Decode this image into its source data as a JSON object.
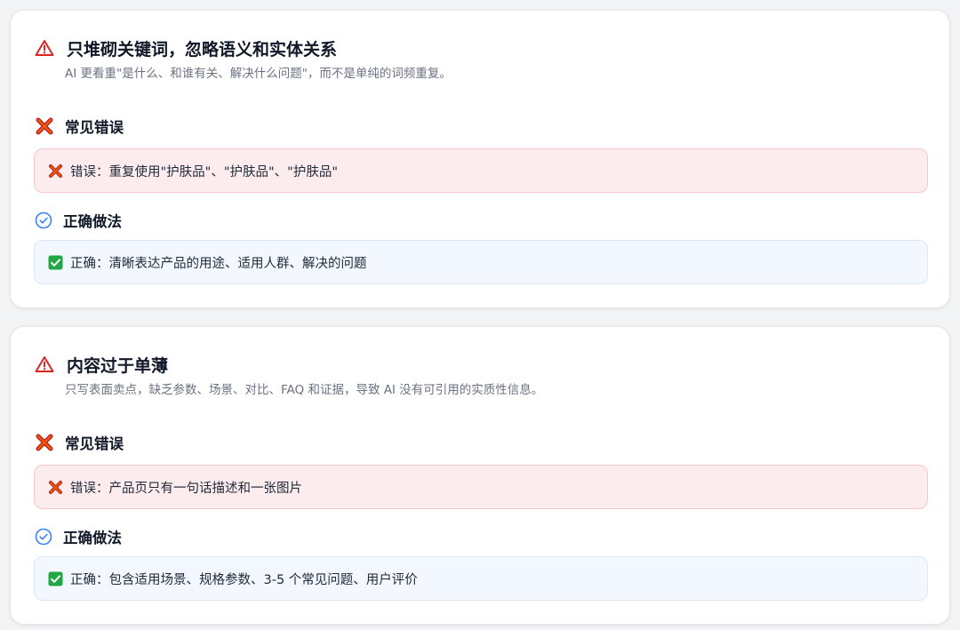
{
  "cards": [
    {
      "title": "只堆砌关键词，忽略语义和实体关系",
      "description": "AI 更看重\"是什么、和谁有关、解决什么问题\"，而不是单纯的词频重复。",
      "wrong_heading": "常见错误",
      "wrong_text": "错误：重复使用\"护肤品\"、\"护肤品\"、\"护肤品\"",
      "right_heading": "正确做法",
      "right_text": "正确：清晰表达产品的用途、适用人群、解决的问题"
    },
    {
      "title": "内容过于单薄",
      "description": "只写表面卖点，缺乏参数、场景、对比、FAQ 和证据，导致 AI 没有可引用的实质性信息。",
      "wrong_heading": "常见错误",
      "wrong_text": "错误：产品页只有一句话描述和一张图片",
      "right_heading": "正确做法",
      "right_text": "正确：包含适用场景、规格参数、3-5 个常见问题、用户评价"
    }
  ],
  "colors": {
    "warning": "#dc2626",
    "cross": "#c2410c",
    "check_circle": "#3b82f6",
    "check_box": "#22a745",
    "wrong_bg": "#fdecee",
    "right_bg": "#f3f7ff"
  },
  "icons": {
    "warning": "warning-triangle-icon",
    "cross": "cross-mark-icon",
    "check_circle": "check-circle-icon",
    "check_box": "check-box-icon"
  }
}
